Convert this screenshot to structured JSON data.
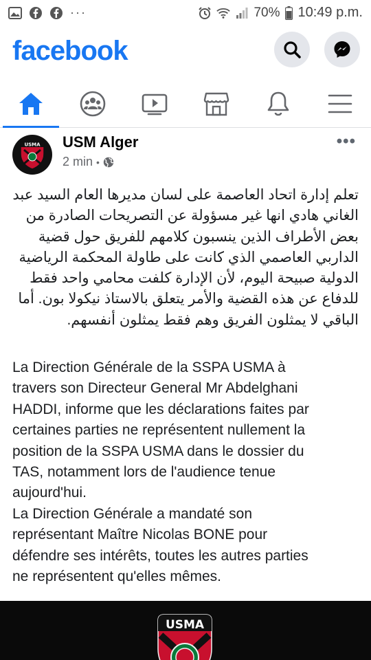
{
  "status_bar": {
    "battery_percent": "70%",
    "time": "10:49 p.m.",
    "ellipsis": "···"
  },
  "header": {
    "logo": "facebook"
  },
  "nav": {
    "tabs": [
      {
        "icon": "home-icon",
        "active": true
      },
      {
        "icon": "groups-icon",
        "active": false
      },
      {
        "icon": "watch-icon",
        "active": false
      },
      {
        "icon": "marketplace-icon",
        "active": false
      },
      {
        "icon": "notifications-icon",
        "active": false
      },
      {
        "icon": "menu-icon",
        "active": false
      }
    ]
  },
  "post": {
    "page_name": "USM Alger",
    "time": "2 min",
    "separator": "•",
    "more": "•••",
    "text_ar": "تعلم إدارة اتحاد العاصمة على لسان مديرها العام السيد عبد\nالغاني هادي انها غير مسؤولة عن التصريحات الصادرة من\nبعض الأطراف الذين ينسبون كلامهم للفريق حول قضية\nالداربي العاصمي الذي كانت على طاولة المحكمة الرياضية\nالدولية صبيحة اليوم، لأن الإدارة كلفت محامي واحد فقط\nللدفاع عن هذه القضية والأمر يتعلق بالاستاذ نيكولا بون. أما\nالباقي لا يمثلون الفريق وهم فقط يمثلون أنفسهم.",
    "text_fr": "La Direction Générale de la SSPA USMA à\ntravers son Directeur General Mr Abdelghani\nHADDI, informe que les déclarations faites par\ncertaines parties ne représentent nullement la\nposition de la SSPA USMA dans le dossier du\nTAS,  notamment lors de l'audience tenue\naujourd'hui.\nLa Direction Générale a mandaté son\nreprésentant Maître Nicolas BONE pour\ndéfendre ses intérêts, toutes les autres parties\nne représentent qu'elles mêmes.",
    "media_badge_text": "USMA"
  },
  "colors": {
    "brand": "#1877f2",
    "badge_red": "#c8102e"
  }
}
